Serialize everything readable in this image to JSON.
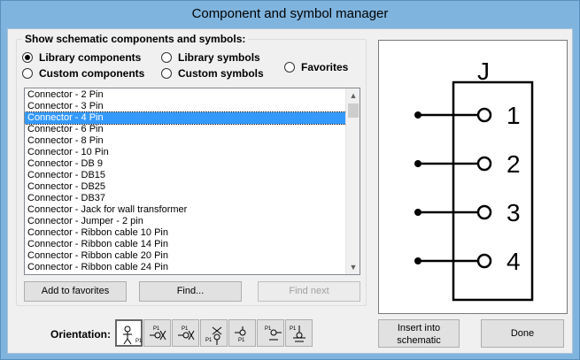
{
  "window": {
    "title": "Component and symbol manager"
  },
  "filter": {
    "group_label": "Show schematic components and symbols:",
    "options": [
      {
        "label": "Library components",
        "selected": true
      },
      {
        "label": "Custom components",
        "selected": false
      },
      {
        "label": "Library symbols",
        "selected": false
      },
      {
        "label": "Custom symbols",
        "selected": false
      },
      {
        "label": "Favorites",
        "selected": false
      }
    ]
  },
  "list": {
    "items": [
      "Connector -  2 Pin",
      "Connector -  3 Pin",
      "Connector -  4 Pin",
      "Connector -  6 Pin",
      "Connector -  8 Pin",
      "Connector - 10 Pin",
      "Connector - DB 9",
      "Connector - DB15",
      "Connector - DB25",
      "Connector - DB37",
      "Connector - Jack for wall transformer",
      "Connector - Jumper - 2 pin",
      "Connector - Ribbon cable 10 Pin",
      "Connector - Ribbon cable 14 Pin",
      "Connector - Ribbon cable 20 Pin",
      "Connector - Ribbon cable 24 Pin"
    ],
    "selected_index": 2
  },
  "buttons": {
    "add_favorites": "Add to favorites",
    "find": "Find...",
    "find_next": "Find next",
    "insert": "Insert into schematic",
    "done": "Done"
  },
  "preview": {
    "ref": "J",
    "pins": [
      "1",
      "2",
      "3",
      "4"
    ]
  },
  "orientation": {
    "label": "Orientation:",
    "options": [
      {
        "name": "orientation-1",
        "text": "P1",
        "selected": true
      },
      {
        "name": "orientation-2",
        "text": "P1",
        "selected": false
      },
      {
        "name": "orientation-3",
        "text": "P1",
        "selected": false
      },
      {
        "name": "orientation-4",
        "text": "P1",
        "selected": false
      },
      {
        "name": "orientation-5",
        "text": "P1",
        "selected": false
      },
      {
        "name": "orientation-6",
        "text": "P1",
        "selected": false
      },
      {
        "name": "orientation-7",
        "text": "P1",
        "selected": false
      }
    ]
  }
}
